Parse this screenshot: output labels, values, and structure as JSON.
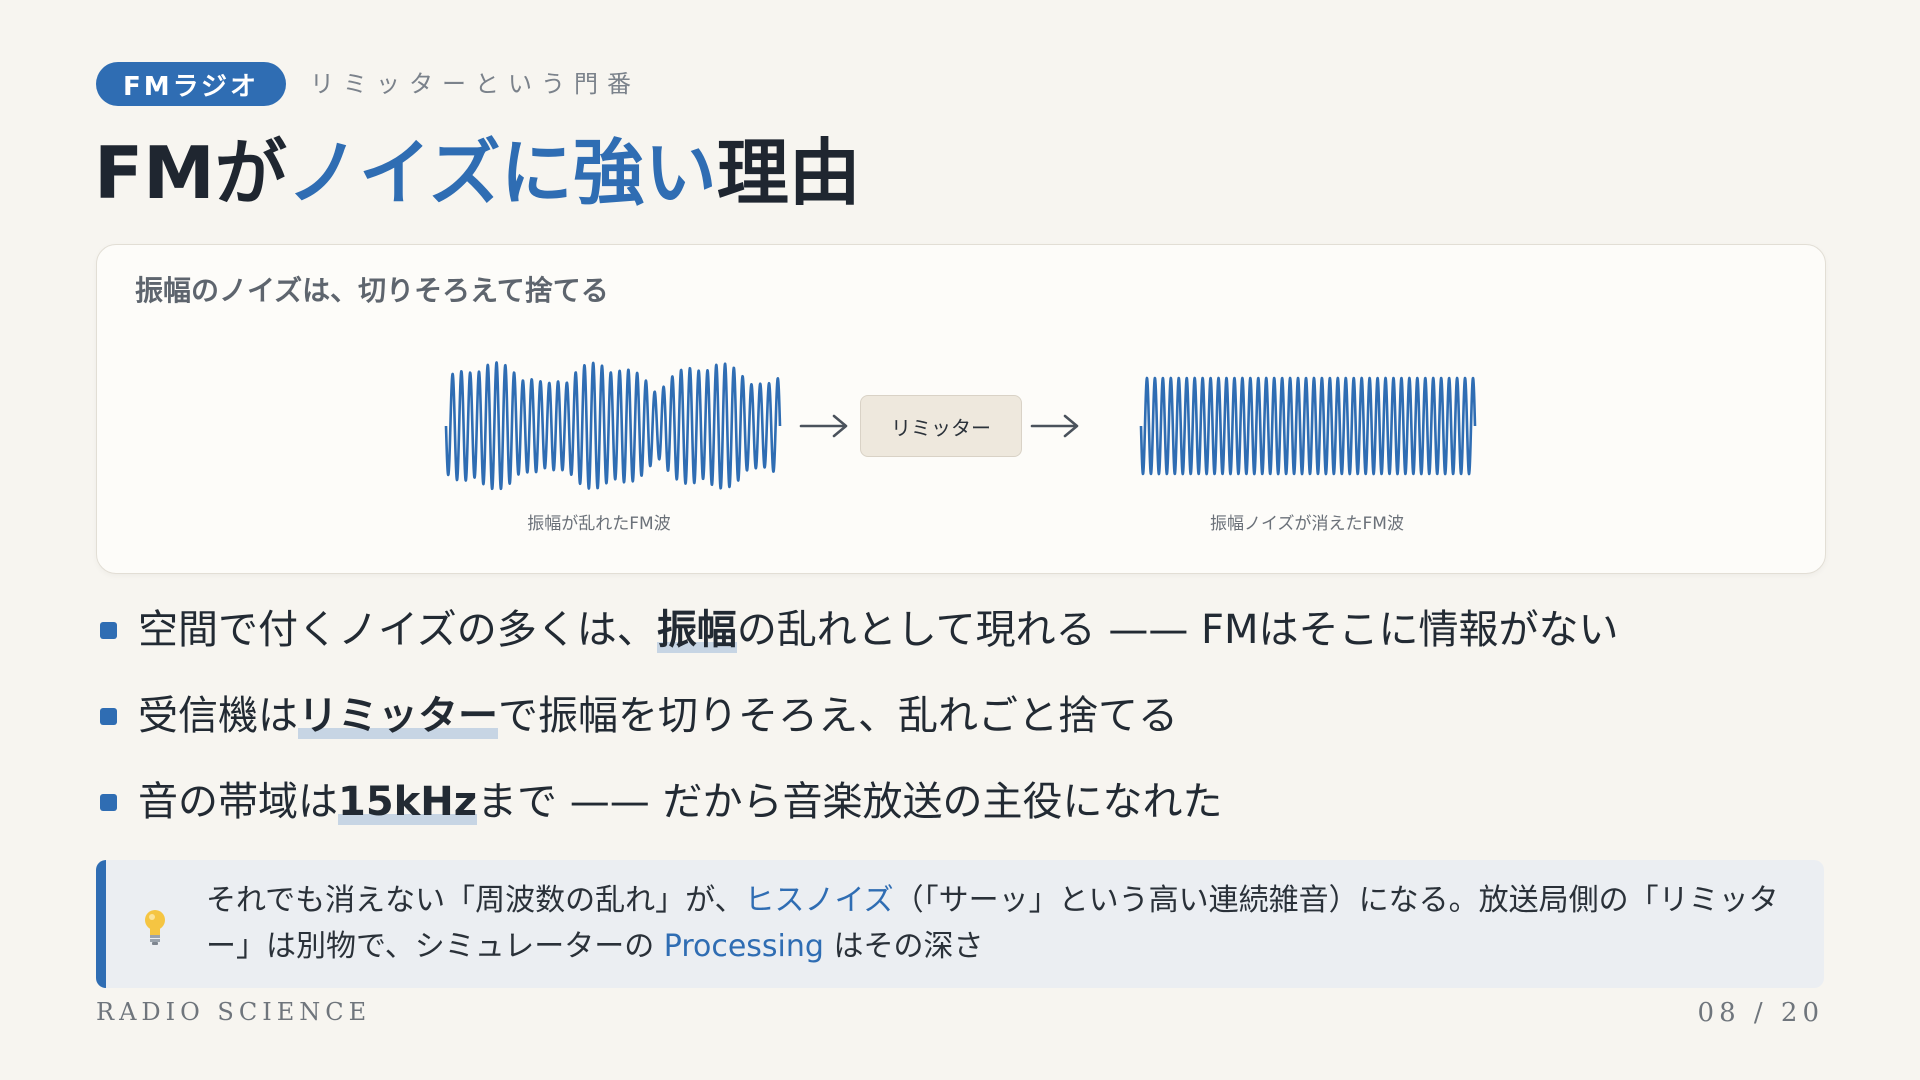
{
  "header": {
    "tag": "FMラジオ",
    "kicker": "リミッターという門番",
    "title_part1": "FMが",
    "title_accent": "ノイズに強い",
    "title_part2": "理由"
  },
  "diagram": {
    "caption": "振幅のノイズは、切りそろえて捨てる",
    "limiter_label": "リミッター",
    "left_label": "振幅が乱れたFM波",
    "right_label": "振幅ノイズが消えたFM波",
    "arrow_icon": "arrow-right-icon"
  },
  "bullets": [
    {
      "pre": "空間で付くノイズの多くは、",
      "hl": "振幅",
      "post": "の乱れとして現れる —— FMはそこに情報がない"
    },
    {
      "pre": "受信機は",
      "hl": "リミッター",
      "post": "で振幅を切りそろえ、乱れごと捨てる"
    },
    {
      "pre": "音の帯域は",
      "hl": "15kHz",
      "post": "まで —— だから音楽放送の主役になれた"
    }
  ],
  "note": {
    "icon": "lightbulb-icon",
    "part1": "それでも消えない「周波数の乱れ」が、",
    "blue1": "ヒスノイズ",
    "part2": "（「サーッ」という高い連続雑音）になる。放送局側の「リミッター」は別物で、シミュレーターの ",
    "blue2": "Processing",
    "part3": " はその深さ"
  },
  "footer": {
    "brand": "RADIO SCIENCE",
    "page": "08 / 20"
  },
  "colors": {
    "accent": "#2f6db3",
    "background": "#f7f5f0",
    "wave": "#2f6db3"
  }
}
